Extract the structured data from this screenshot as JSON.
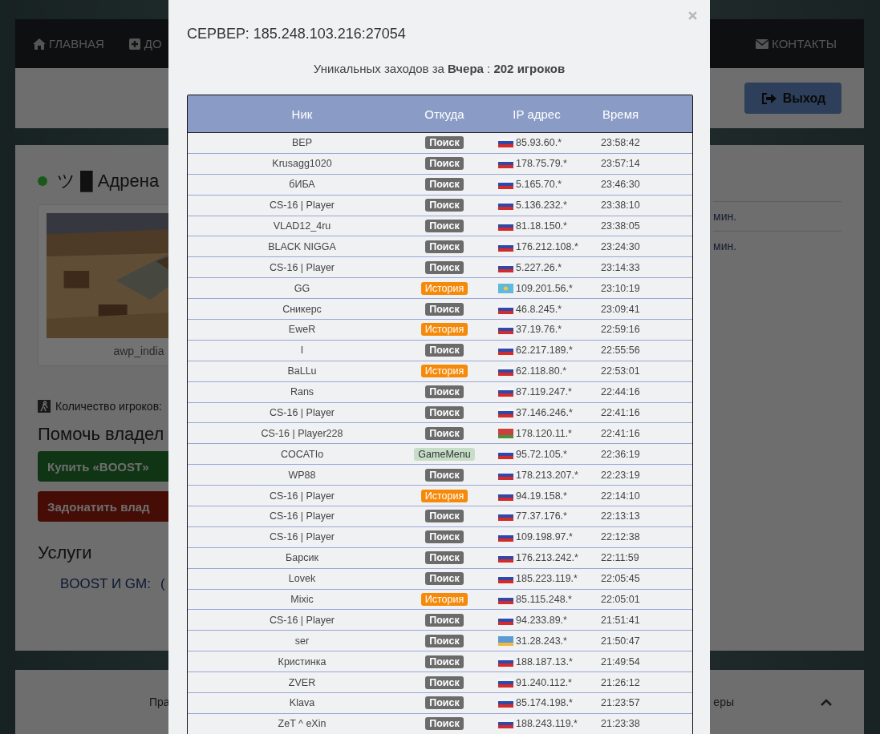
{
  "navbar": {
    "items": [
      {
        "kind": "home",
        "label": "ГЛАВНАЯ"
      },
      {
        "kind": "add",
        "label": "ДО"
      },
      {
        "kind": "contacts",
        "label": "КОНТАКТЫ"
      }
    ]
  },
  "logout_button": {
    "label": "Выход"
  },
  "server_card": {
    "online": true,
    "name": "ツ █ Адрена",
    "map_name": "awp_india",
    "players_label": "Количество игроков:",
    "help_title": "Помочь владел",
    "buy_button": "Купить «BOOST»",
    "donate_button": "Задонатить влад",
    "services_title": "Услуги",
    "services_row": "BOOST И GM:",
    "services_paren": "(",
    "side_rows": [
      "мин.",
      "мин."
    ]
  },
  "footer": {
    "left_text": "Пра",
    "right_text": "еры"
  },
  "modal": {
    "title": "СЕРВЕР: 185.248.103.216:27054",
    "summary": "Уникальных заходов за **Вчера** : **202 игроков**",
    "columns": [
      "Ник",
      "Откуда",
      "IP адрес",
      "Время"
    ],
    "rows": [
      {
        "nick": "BEP",
        "source": {
          "kind": "search",
          "label": "Поиск"
        },
        "flag": {
          "kind": "ru"
        },
        "ip": "85.93.60.*",
        "time": "23:58:42"
      },
      {
        "nick": "Krusagg1020",
        "source": {
          "kind": "search",
          "label": "Поиск"
        },
        "flag": {
          "kind": "ru"
        },
        "ip": "178.75.79.*",
        "time": "23:57:14"
      },
      {
        "nick": "бИБА",
        "source": {
          "kind": "search",
          "label": "Поиск"
        },
        "flag": {
          "kind": "ru"
        },
        "ip": "5.165.70.*",
        "time": "23:46:30"
      },
      {
        "nick": "CS-16 | Player",
        "source": {
          "kind": "search",
          "label": "Поиск"
        },
        "flag": {
          "kind": "ru"
        },
        "ip": "5.136.232.*",
        "time": "23:38:10"
      },
      {
        "nick": "VLAD12_4ru",
        "source": {
          "kind": "search",
          "label": "Поиск"
        },
        "flag": {
          "kind": "ru"
        },
        "ip": "81.18.150.*",
        "time": "23:38:05"
      },
      {
        "nick": "BLACK NIGGA",
        "source": {
          "kind": "search",
          "label": "Поиск"
        },
        "flag": {
          "kind": "ru"
        },
        "ip": "176.212.108.*",
        "time": "23:24:30"
      },
      {
        "nick": "CS-16 | Player",
        "source": {
          "kind": "search",
          "label": "Поиск"
        },
        "flag": {
          "kind": "ru"
        },
        "ip": "5.227.26.*",
        "time": "23:14:33"
      },
      {
        "nick": "GG",
        "source": {
          "kind": "history",
          "label": "История"
        },
        "flag": {
          "kind": "kz"
        },
        "ip": "109.201.56.*",
        "time": "23:10:19"
      },
      {
        "nick": "Сникерс",
        "source": {
          "kind": "search",
          "label": "Поиск"
        },
        "flag": {
          "kind": "ru"
        },
        "ip": "46.8.245.*",
        "time": "23:09:41"
      },
      {
        "nick": "EweR",
        "source": {
          "kind": "history",
          "label": "История"
        },
        "flag": {
          "kind": "ru"
        },
        "ip": "37.19.76.*",
        "time": "22:59:16"
      },
      {
        "nick": "I",
        "source": {
          "kind": "search",
          "label": "Поиск"
        },
        "flag": {
          "kind": "ru"
        },
        "ip": "62.217.189.*",
        "time": "22:55:56"
      },
      {
        "nick": "BaLLu",
        "source": {
          "kind": "history",
          "label": "История"
        },
        "flag": {
          "kind": "ru"
        },
        "ip": "62.118.80.*",
        "time": "22:53:01"
      },
      {
        "nick": "Rans",
        "source": {
          "kind": "search",
          "label": "Поиск"
        },
        "flag": {
          "kind": "ru"
        },
        "ip": "87.119.247.*",
        "time": "22:44:16"
      },
      {
        "nick": "CS-16 | Player",
        "source": {
          "kind": "search",
          "label": "Поиск"
        },
        "flag": {
          "kind": "ru"
        },
        "ip": "37.146.246.*",
        "time": "22:41:16"
      },
      {
        "nick": "CS-16 | Player228",
        "source": {
          "kind": "search",
          "label": "Поиск"
        },
        "flag": {
          "kind": "by"
        },
        "ip": "178.120.11.*",
        "time": "22:41:16"
      },
      {
        "nick": "COCATIo",
        "source": {
          "kind": "gamemenu",
          "label": "GameMenu"
        },
        "flag": {
          "kind": "ru"
        },
        "ip": "95.72.105.*",
        "time": "22:36:19"
      },
      {
        "nick": "WP88",
        "source": {
          "kind": "search",
          "label": "Поиск"
        },
        "flag": {
          "kind": "ru"
        },
        "ip": "178.213.207.*",
        "time": "22:23:19"
      },
      {
        "nick": "CS-16 | Player",
        "source": {
          "kind": "history",
          "label": "История"
        },
        "flag": {
          "kind": "ru"
        },
        "ip": "94.19.158.*",
        "time": "22:14:10"
      },
      {
        "nick": "CS-16 | Player",
        "source": {
          "kind": "search",
          "label": "Поиск"
        },
        "flag": {
          "kind": "ru"
        },
        "ip": "77.37.176.*",
        "time": "22:13:13"
      },
      {
        "nick": "CS-16 | Player",
        "source": {
          "kind": "search",
          "label": "Поиск"
        },
        "flag": {
          "kind": "ru"
        },
        "ip": "109.198.97.*",
        "time": "22:12:38"
      },
      {
        "nick": "Барсик",
        "source": {
          "kind": "search",
          "label": "Поиск"
        },
        "flag": {
          "kind": "ru"
        },
        "ip": "176.213.242.*",
        "time": "22:11:59"
      },
      {
        "nick": "Lovek",
        "source": {
          "kind": "search",
          "label": "Поиск"
        },
        "flag": {
          "kind": "ru"
        },
        "ip": "185.223.119.*",
        "time": "22:05:45"
      },
      {
        "nick": "Mixic",
        "source": {
          "kind": "history",
          "label": "История"
        },
        "flag": {
          "kind": "ru"
        },
        "ip": "85.115.248.*",
        "time": "22:05:01"
      },
      {
        "nick": "CS-16 | Player",
        "source": {
          "kind": "search",
          "label": "Поиск"
        },
        "flag": {
          "kind": "ru"
        },
        "ip": "94.233.89.*",
        "time": "21:51:41"
      },
      {
        "nick": "ser",
        "source": {
          "kind": "search",
          "label": "Поиск"
        },
        "flag": {
          "kind": "ua"
        },
        "ip": "31.28.243.*",
        "time": "21:50:47"
      },
      {
        "nick": "Кристинка",
        "source": {
          "kind": "search",
          "label": "Поиск"
        },
        "flag": {
          "kind": "ru"
        },
        "ip": "188.187.13.*",
        "time": "21:49:54"
      },
      {
        "nick": "ZVER",
        "source": {
          "kind": "search",
          "label": "Поиск"
        },
        "flag": {
          "kind": "ru"
        },
        "ip": "91.240.112.*",
        "time": "21:26:12"
      },
      {
        "nick": "Klava",
        "source": {
          "kind": "search",
          "label": "Поиск"
        },
        "flag": {
          "kind": "ru"
        },
        "ip": "85.174.198.*",
        "time": "21:23:57"
      },
      {
        "nick": "ZeT ^ eXin",
        "source": {
          "kind": "search",
          "label": "Поиск"
        },
        "flag": {
          "kind": "ru"
        },
        "ip": "188.243.119.*",
        "time": "21:23:38"
      }
    ]
  }
}
